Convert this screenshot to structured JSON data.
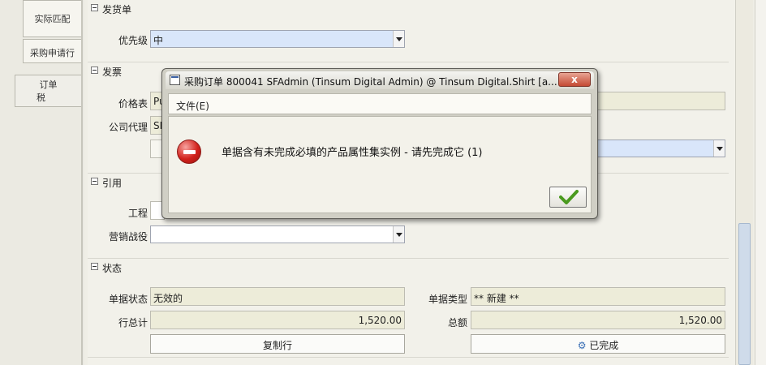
{
  "left_tabs": [
    {
      "label": "实际匹配"
    },
    {
      "label": "采购申请行"
    },
    {
      "label_line1": "订单",
      "label_line2": "税"
    }
  ],
  "sections": {
    "delivery": {
      "title": "发货单",
      "priority_label": "优先级",
      "priority_value": "中"
    },
    "invoice": {
      "title": "发票",
      "price_list_label": "价格表",
      "price_list_value": "Pu",
      "company_agent_label": "公司代理",
      "company_agent_value": "SF"
    },
    "reference": {
      "title": "引用",
      "project_label": "工程",
      "project_value": "",
      "campaign_label": "营销战役",
      "campaign_value": ""
    },
    "status": {
      "title": "状态",
      "doc_status_label": "单据状态",
      "doc_status_value": "无效的",
      "doc_type_label": "单据类型",
      "doc_type_value": "** 新建 **",
      "line_total_label": "行总计",
      "line_total_value": "1,520.00",
      "grand_total_label": "总额",
      "grand_total_value": "1,520.00",
      "copy_lines_button": "复制行",
      "complete_button": "已完成"
    }
  },
  "dialog": {
    "title": "采购订单  800041  SFAdmin (Tinsum Digital Admin) @ Tinsum Digital.Shirt [a...",
    "close_label": "x",
    "menu_file": "文件(E)",
    "message": "单据含有未完成必填的产品属性集实例 - 请先完成它 (1)"
  },
  "colors": {
    "error_red": "#d2221c",
    "ok_check_green": "#4a9a1e",
    "combo_highlight": "#d9e6fa",
    "readonly_field": "#edecd9"
  },
  "icons": [
    "window-icon",
    "close-icon",
    "error-icon",
    "checkmark-icon",
    "gear-icon",
    "dropdown-arrow-icon",
    "section-collapse-icon"
  ]
}
